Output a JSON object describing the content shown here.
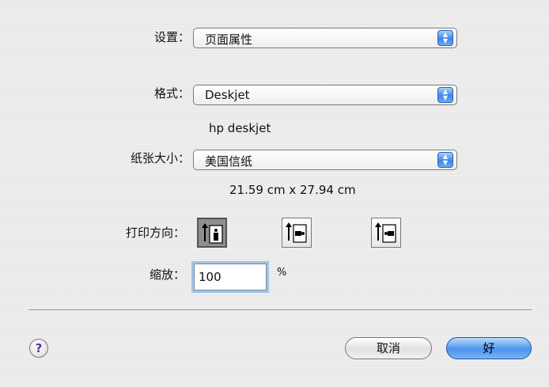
{
  "settings": {
    "label": "设置：",
    "value": "页面属性"
  },
  "format": {
    "label": "格式：",
    "value": "Deskjet",
    "printer_name": "hp deskjet"
  },
  "paper": {
    "label": "纸张大小：",
    "value": "美国信纸",
    "dimensions": "21.59 cm x 27.94 cm"
  },
  "orientation": {
    "label": "打印方向：",
    "options": [
      {
        "icon": "portrait-orientation-icon",
        "selected": true
      },
      {
        "icon": "landscape-orientation-icon",
        "selected": false
      },
      {
        "icon": "reverse-landscape-orientation-icon",
        "selected": false
      }
    ]
  },
  "scale": {
    "label": "缩放：",
    "value": "100",
    "unit": "%"
  },
  "buttons": {
    "help": "?",
    "cancel": "取消",
    "ok": "好"
  },
  "colors": {
    "accent": "#4b93ee",
    "focus_ring": "#9cc3ee",
    "selected_orientation": "#8e8e8e"
  }
}
